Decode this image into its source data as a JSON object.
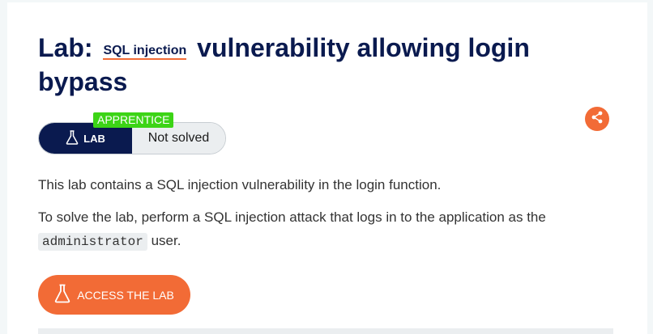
{
  "title": {
    "prefix": "Lab:",
    "term": "SQL injection",
    "rest": "vulnerability allowing login bypass"
  },
  "badge": {
    "level": "APPRENTICE"
  },
  "status": {
    "lab_label": "LAB",
    "state": "Not solved"
  },
  "description": {
    "line1": "This lab contains a SQL injection vulnerability in the login function.",
    "line2_before": "To solve the lab, perform a SQL injection attack that logs in to the application as the",
    "code": "administrator",
    "line2_after": "user."
  },
  "actions": {
    "access_label": "ACCESS THE LAB"
  },
  "icons": {
    "share": "share-icon",
    "flask": "flask-icon"
  },
  "colors": {
    "navy": "#0a1a4f",
    "orange": "#f26b36",
    "green": "#3cd416"
  }
}
